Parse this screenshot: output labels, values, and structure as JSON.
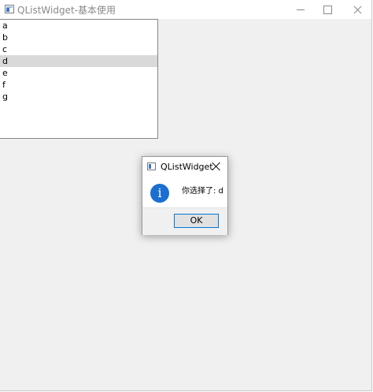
{
  "window": {
    "title": "QListWidget-基本使用"
  },
  "list": {
    "items": [
      "a",
      "b",
      "c",
      "d",
      "e",
      "f",
      "g"
    ],
    "selected": "d"
  },
  "message_box": {
    "title": "QListWidget",
    "text": "你选择了: d",
    "ok_label": "OK",
    "icon": "information-icon"
  },
  "colors": {
    "accent": "#0078d7",
    "info_icon": "#1a6fd0",
    "selection": "#d9d9d9"
  }
}
